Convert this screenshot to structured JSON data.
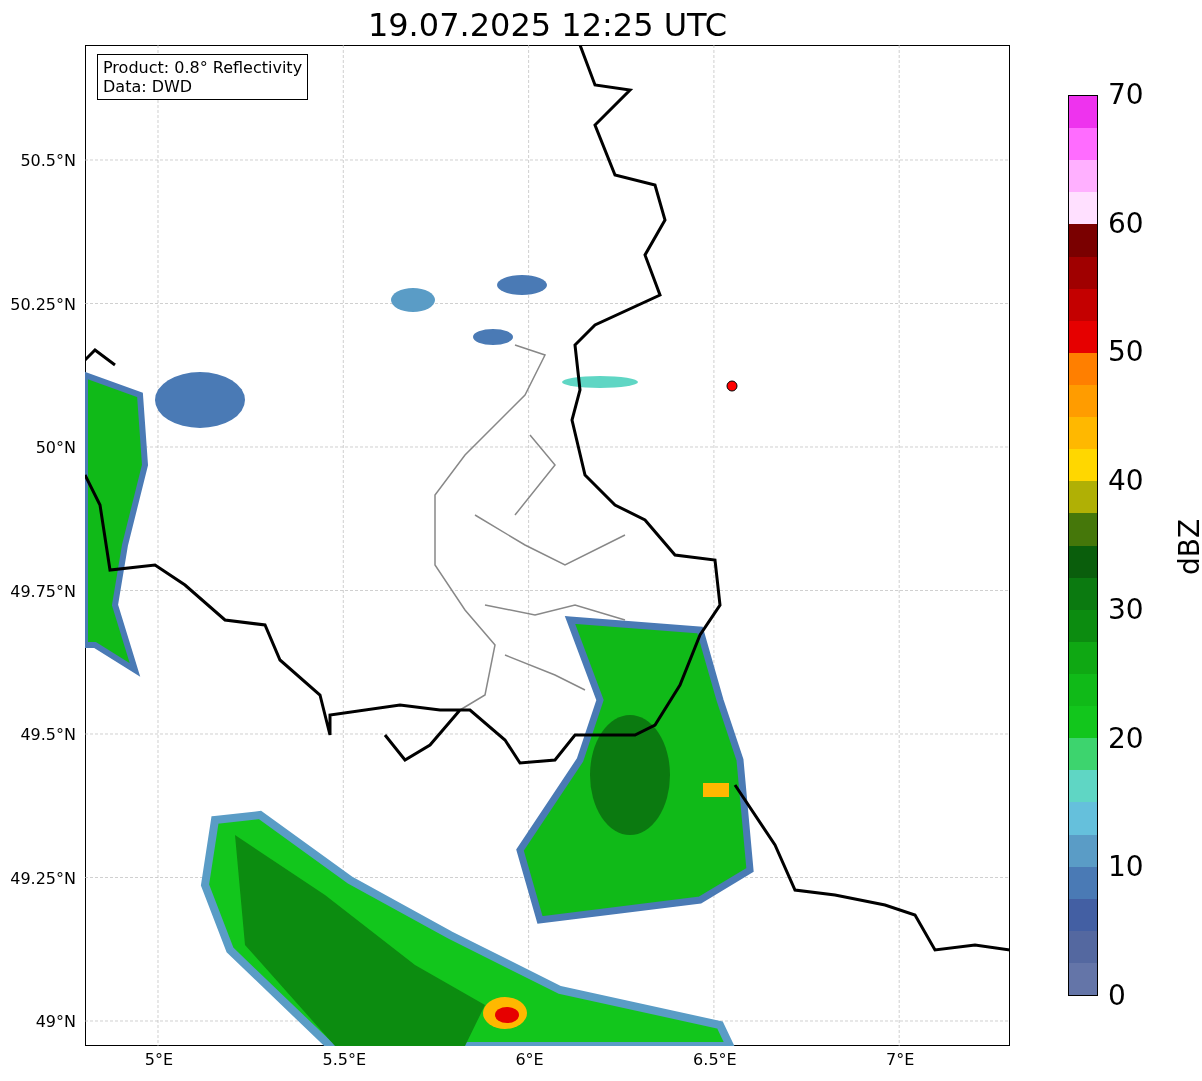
{
  "title": "19.07.2025 12:25 UTC",
  "map": {
    "info_box": [
      "Product: 0.8° Reflectivity",
      "Data: DWD"
    ],
    "lat_ticks": [
      "50.5°N",
      "50.25°N",
      "50°N",
      "49.75°N",
      "49.5°N",
      "49.25°N",
      "49°N"
    ],
    "lon_ticks": [
      "5°E",
      "5.5°E",
      "6°E",
      "6.5°E",
      "7°E"
    ]
  },
  "colorbar": {
    "label": "dBZ",
    "ticks": [
      "70",
      "60",
      "50",
      "40",
      "30",
      "20",
      "10",
      "0"
    ],
    "bands": [
      {
        "color": "#ee33ee"
      },
      {
        "color": "#ff6cff"
      },
      {
        "color": "#ffb0ff"
      },
      {
        "color": "#ffe0ff"
      },
      {
        "color": "#7a0000"
      },
      {
        "color": "#a00000"
      },
      {
        "color": "#c40000"
      },
      {
        "color": "#e60000"
      },
      {
        "color": "#ff7f00"
      },
      {
        "color": "#ff9c00"
      },
      {
        "color": "#ffb800"
      },
      {
        "color": "#ffd700"
      },
      {
        "color": "#b0b005"
      },
      {
        "color": "#45770a"
      },
      {
        "color": "#0a5e0c"
      },
      {
        "color": "#0b7a10"
      },
      {
        "color": "#0c8c10"
      },
      {
        "color": "#0fa813"
      },
      {
        "color": "#10ba18"
      },
      {
        "color": "#12c61c"
      },
      {
        "color": "#3dd46e"
      },
      {
        "color": "#5fd6c4"
      },
      {
        "color": "#65c0dc"
      },
      {
        "color": "#5a9cc6"
      },
      {
        "color": "#4a7ab5"
      },
      {
        "color": "#435fa3"
      },
      {
        "color": "#5468a0"
      },
      {
        "color": "#6475a8"
      }
    ]
  }
}
